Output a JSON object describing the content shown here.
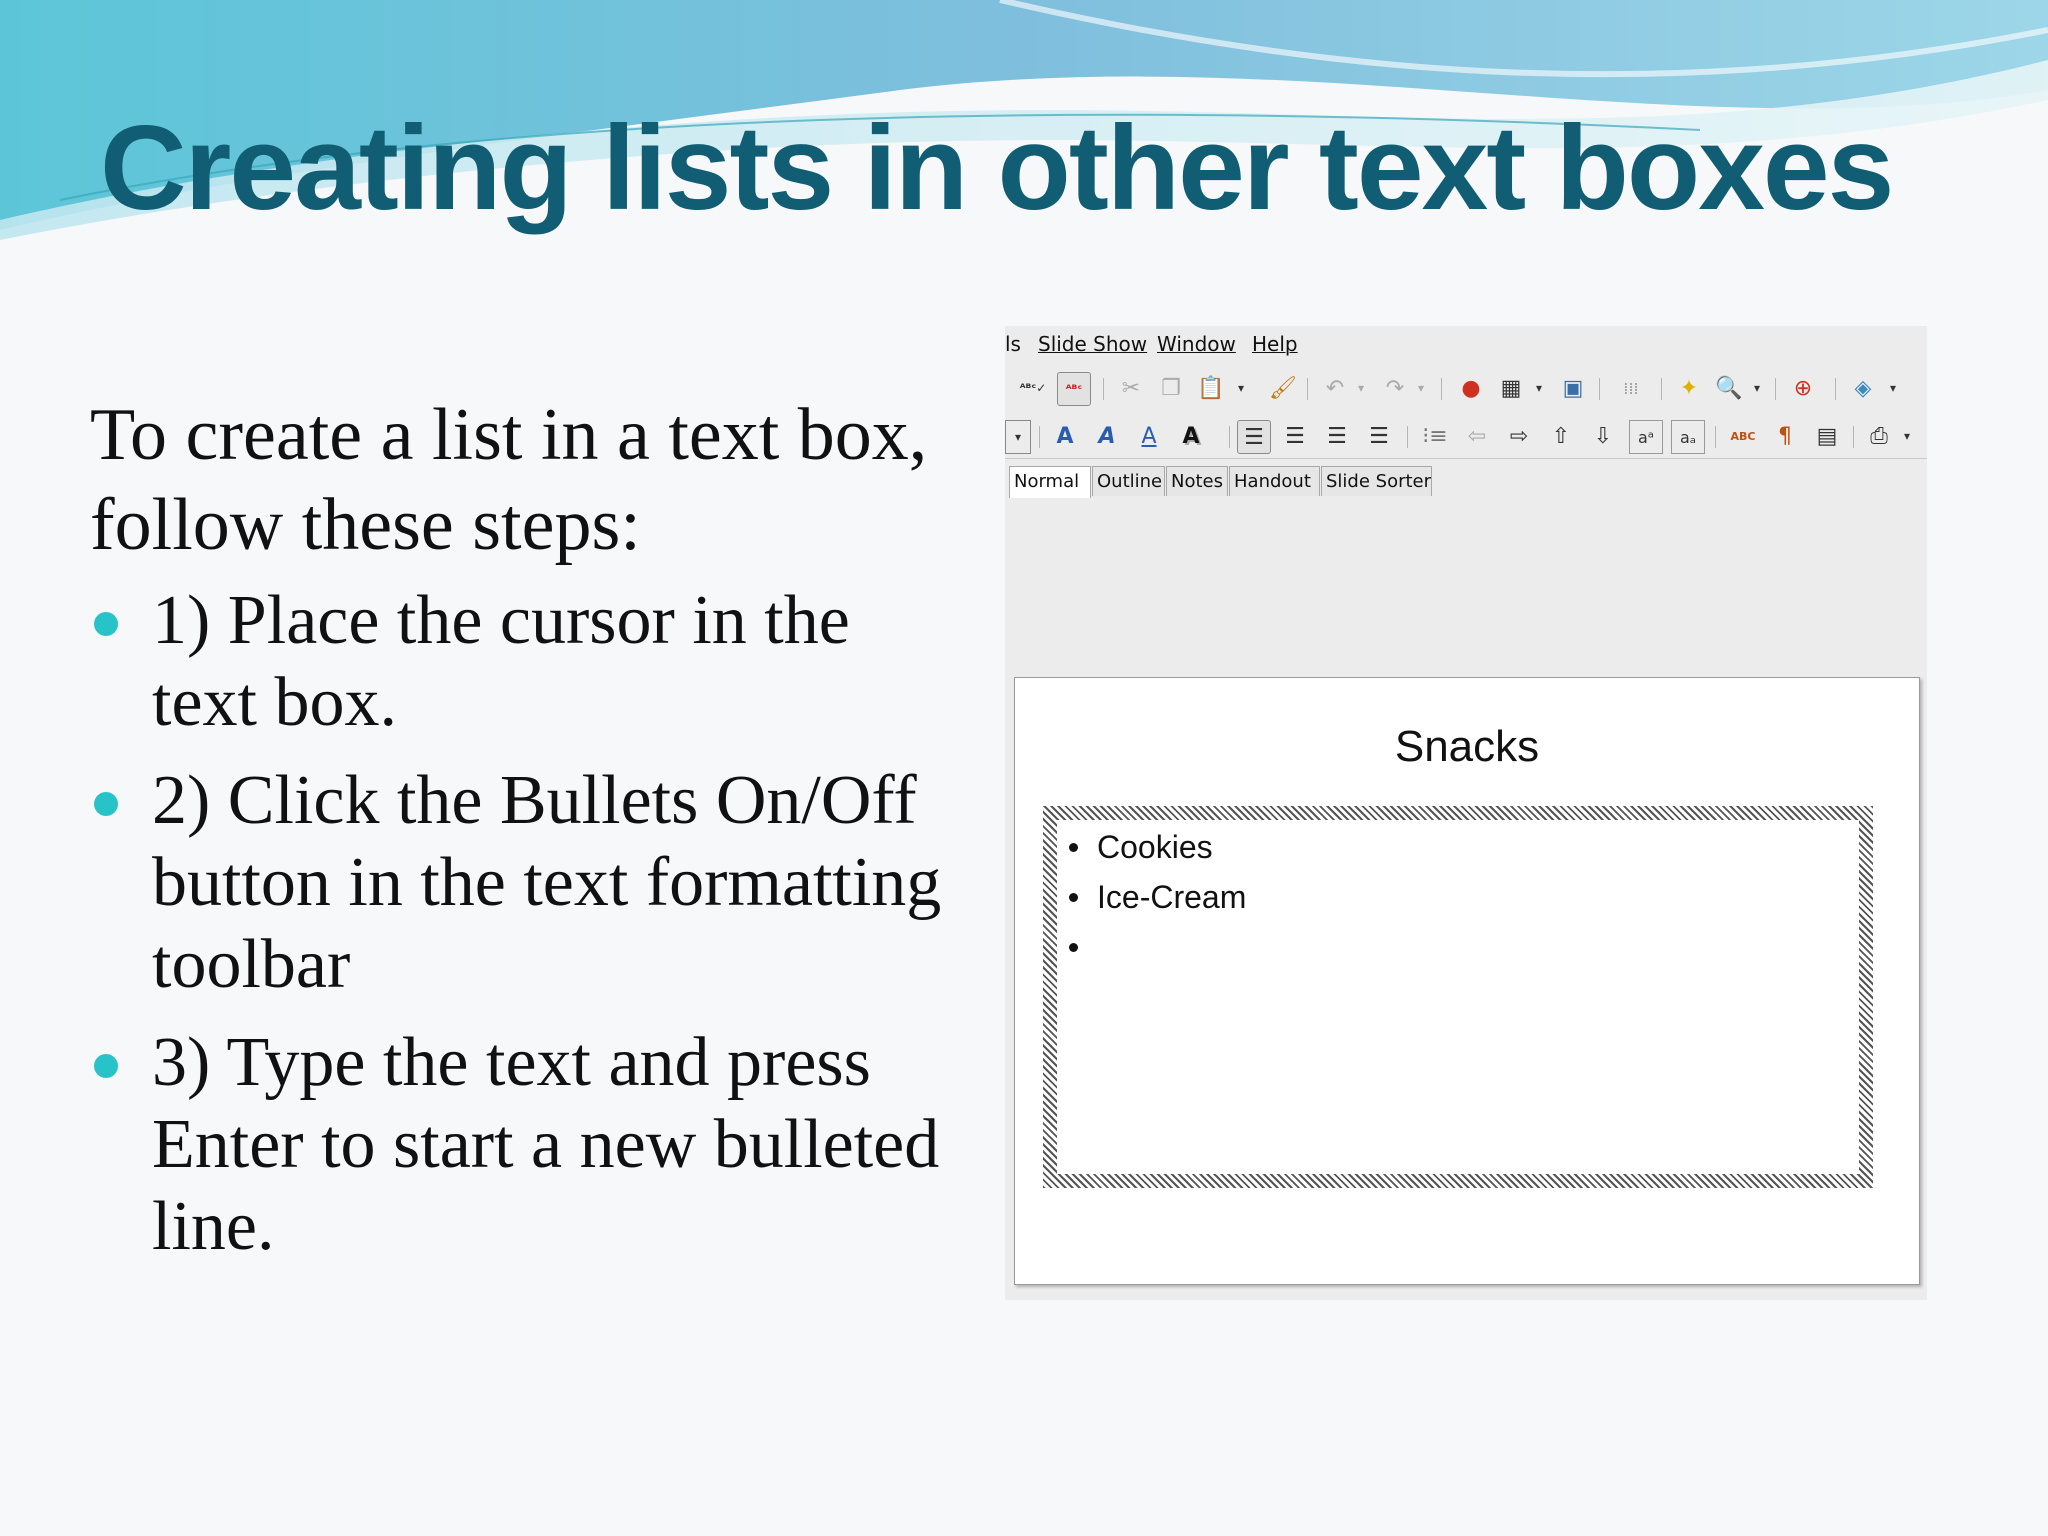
{
  "slide": {
    "title": "Creating lists in other text boxes",
    "intro": "To create a list in a text box, follow these steps:",
    "steps": [
      "1) Place the cursor in the text box.",
      "2) Click the Bullets On/Off button in the text formatting toolbar",
      "3) Type the text and press Enter to start a new bulleted line."
    ]
  },
  "screenshot": {
    "menu": [
      "ls",
      "Slide Show",
      "Window",
      "Help"
    ],
    "view_tabs": [
      "Normal",
      "Outline",
      "Notes",
      "Handout",
      "Slide Sorter"
    ],
    "active_tab": "Normal",
    "toolbar_standard_icons": [
      "spellcheck-icon",
      "autospellcheck-icon",
      "cut-icon",
      "copy-icon",
      "paste-icon",
      "clone-formatting-icon",
      "undo-icon",
      "redo-icon",
      "chart-icon",
      "table-icon",
      "image-icon",
      "grid-icon",
      "star-icon",
      "zoom-icon",
      "help-icon",
      "navigator-icon"
    ],
    "toolbar_format_icons": [
      "dropdown-icon",
      "bold-icon",
      "italic-icon",
      "underline-icon",
      "shadow-icon",
      "align-left-icon",
      "align-center-icon",
      "align-right-icon",
      "justify-icon",
      "bullets-icon",
      "demote-icon",
      "promote-icon",
      "move-up-icon",
      "move-down-icon",
      "superscript-icon",
      "subscript-icon",
      "spellcheck-abc-icon",
      "paragraph-icon",
      "list-icon",
      "format-icon"
    ],
    "slide_title": "Snacks",
    "list_items": [
      "Cookies",
      "Ice-Cream",
      ""
    ]
  },
  "colors": {
    "title": "#115e74",
    "bullet": "#27c3c9"
  }
}
